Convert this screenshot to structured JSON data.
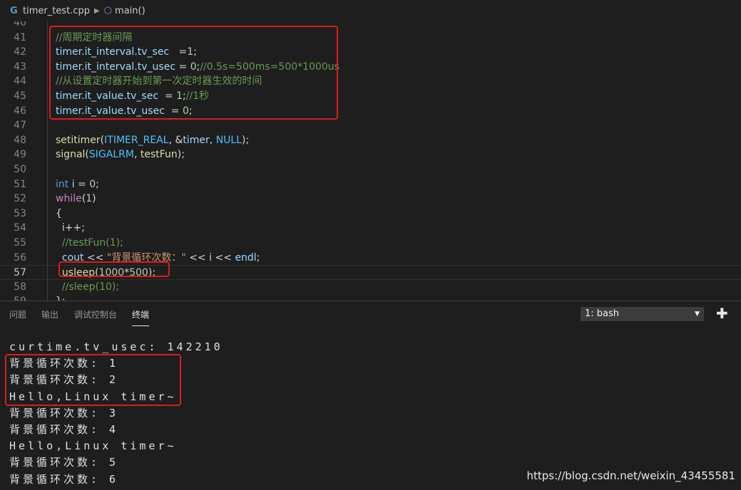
{
  "breadcrumb": {
    "file_icon": "cpp-file-icon",
    "file": "timer_test.cpp",
    "symbol_icon": "method-cube-icon",
    "symbol": "main()"
  },
  "editor": {
    "current_line": "57",
    "lines": [
      {
        "n": "40",
        "segs": [
          {
            "t": "",
            "c": ""
          }
        ]
      },
      {
        "n": "41",
        "segs": [
          {
            "t": "//周期定时器间隔",
            "c": "cm"
          }
        ]
      },
      {
        "n": "42",
        "segs": [
          {
            "t": "timer",
            "c": "var"
          },
          {
            "t": ".",
            "c": ""
          },
          {
            "t": "it_interval",
            "c": "var"
          },
          {
            "t": ".",
            "c": ""
          },
          {
            "t": "tv_sec",
            "c": "var"
          },
          {
            "t": "   =",
            "c": ""
          },
          {
            "t": "1",
            "c": "num"
          },
          {
            "t": ";",
            "c": ""
          }
        ]
      },
      {
        "n": "43",
        "segs": [
          {
            "t": "timer",
            "c": "var"
          },
          {
            "t": ".",
            "c": ""
          },
          {
            "t": "it_interval",
            "c": "var"
          },
          {
            "t": ".",
            "c": ""
          },
          {
            "t": "tv_usec",
            "c": "var"
          },
          {
            "t": " = ",
            "c": ""
          },
          {
            "t": "0",
            "c": "num"
          },
          {
            "t": ";",
            "c": ""
          },
          {
            "t": "//0.5s=500ms=500*1000us",
            "c": "cm"
          }
        ]
      },
      {
        "n": "44",
        "segs": [
          {
            "t": "//从设置定时器开始到第一次定时器生效的时间",
            "c": "cm"
          }
        ]
      },
      {
        "n": "45",
        "segs": [
          {
            "t": "timer",
            "c": "var"
          },
          {
            "t": ".",
            "c": ""
          },
          {
            "t": "it_value",
            "c": "var"
          },
          {
            "t": ".",
            "c": ""
          },
          {
            "t": "tv_sec",
            "c": "var"
          },
          {
            "t": "  = ",
            "c": ""
          },
          {
            "t": "1",
            "c": "num"
          },
          {
            "t": ";",
            "c": ""
          },
          {
            "t": "//1秒",
            "c": "cm"
          }
        ]
      },
      {
        "n": "46",
        "segs": [
          {
            "t": "timer",
            "c": "var"
          },
          {
            "t": ".",
            "c": ""
          },
          {
            "t": "it_value",
            "c": "var"
          },
          {
            "t": ".",
            "c": ""
          },
          {
            "t": "tv_usec",
            "c": "var"
          },
          {
            "t": "  = ",
            "c": ""
          },
          {
            "t": "0",
            "c": "num"
          },
          {
            "t": ";",
            "c": ""
          }
        ]
      },
      {
        "n": "47",
        "segs": [
          {
            "t": "",
            "c": ""
          }
        ]
      },
      {
        "n": "48",
        "segs": [
          {
            "t": "setitimer",
            "c": "fn"
          },
          {
            "t": "(",
            "c": ""
          },
          {
            "t": "ITIMER_REAL",
            "c": "const"
          },
          {
            "t": ", &",
            "c": ""
          },
          {
            "t": "timer",
            "c": "var"
          },
          {
            "t": ", ",
            "c": ""
          },
          {
            "t": "NULL",
            "c": "const"
          },
          {
            "t": ");",
            "c": ""
          }
        ]
      },
      {
        "n": "49",
        "segs": [
          {
            "t": "signal",
            "c": "fn"
          },
          {
            "t": "(",
            "c": ""
          },
          {
            "t": "SIGALRM",
            "c": "const"
          },
          {
            "t": ", ",
            "c": ""
          },
          {
            "t": "testFun",
            "c": "fn"
          },
          {
            "t": ");",
            "c": ""
          }
        ]
      },
      {
        "n": "50",
        "segs": [
          {
            "t": "",
            "c": ""
          }
        ]
      },
      {
        "n": "51",
        "segs": [
          {
            "t": "int",
            "c": "kw"
          },
          {
            "t": " ",
            "c": ""
          },
          {
            "t": "i",
            "c": "var"
          },
          {
            "t": " = ",
            "c": ""
          },
          {
            "t": "0",
            "c": "num"
          },
          {
            "t": ";",
            "c": ""
          }
        ]
      },
      {
        "n": "52",
        "segs": [
          {
            "t": "while",
            "c": "ctl"
          },
          {
            "t": "(",
            "c": ""
          },
          {
            "t": "1",
            "c": "num"
          },
          {
            "t": ")",
            "c": ""
          }
        ]
      },
      {
        "n": "53",
        "segs": [
          {
            "t": "{",
            "c": ""
          }
        ]
      },
      {
        "n": "54",
        "segs": [
          {
            "t": "  ",
            "c": ""
          },
          {
            "t": "i",
            "c": "var"
          },
          {
            "t": "++;",
            "c": ""
          }
        ]
      },
      {
        "n": "55",
        "segs": [
          {
            "t": "  ",
            "c": ""
          },
          {
            "t": "//testFun(1);",
            "c": "cm"
          }
        ]
      },
      {
        "n": "56",
        "segs": [
          {
            "t": "  ",
            "c": ""
          },
          {
            "t": "cout",
            "c": "var"
          },
          {
            "t": " << ",
            "c": ""
          },
          {
            "t": "\"背景循环次数：\"",
            "c": "str"
          },
          {
            "t": " << ",
            "c": ""
          },
          {
            "t": "i",
            "c": "var"
          },
          {
            "t": " << ",
            "c": ""
          },
          {
            "t": "endl",
            "c": "var"
          },
          {
            "t": ";",
            "c": ""
          }
        ]
      },
      {
        "n": "57",
        "segs": [
          {
            "t": "  ",
            "c": ""
          },
          {
            "t": "usleep",
            "c": "fn"
          },
          {
            "t": "(",
            "c": ""
          },
          {
            "t": "1000",
            "c": "num"
          },
          {
            "t": "*",
            "c": ""
          },
          {
            "t": "500",
            "c": "num"
          },
          {
            "t": ");",
            "c": ""
          }
        ]
      },
      {
        "n": "58",
        "segs": [
          {
            "t": "  ",
            "c": ""
          },
          {
            "t": "//sleep(10);",
            "c": "cm"
          }
        ]
      },
      {
        "n": "59",
        "segs": [
          {
            "t": "};",
            "c": ""
          }
        ]
      }
    ]
  },
  "panel": {
    "tabs": [
      "问题",
      "输出",
      "调试控制台",
      "终端"
    ],
    "active_tab": "终端",
    "terminal_select": "1: bash",
    "add_icon": "plus-icon"
  },
  "terminal": {
    "lines": [
      "curtime.tv_usec: 142210",
      "背景循环次数: 1",
      "背景循环次数: 2",
      "Hello,Linux timer~",
      "背景循环次数: 3",
      "背景循环次数: 4",
      "Hello,Linux timer~",
      "背景循环次数: 5",
      "背景循环次数: 6"
    ]
  },
  "watermark": "https://blog.csdn.net/weixin_43455581",
  "colors": {
    "background": "#1e1e1e",
    "highlight_box": "#e0181d",
    "comment": "#6a9955",
    "variable": "#9cdcfe",
    "function": "#dcdcaa",
    "keyword": "#569cd6",
    "string": "#ce9178"
  }
}
